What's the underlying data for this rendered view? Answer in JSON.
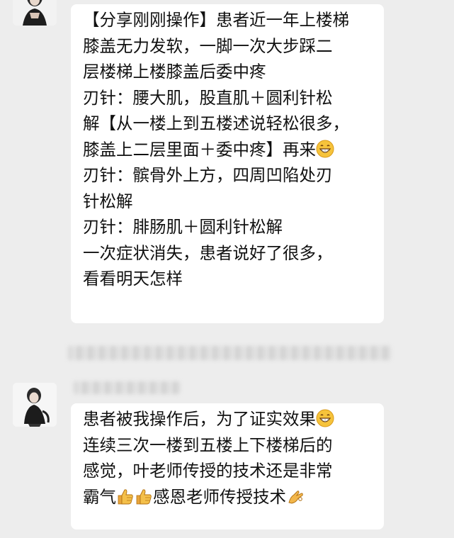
{
  "message1": {
    "lines": [
      "【分享刚刚操作】患者近一年上楼梯",
      "膝盖无力发软，一脚一次大步踩二",
      "层楼梯上楼膝盖后委中疼",
      "刃针：腰大肌，股直肌＋圆利针松",
      "解【从一楼上到五楼述说轻松很多，",
      "膝盖上二层里面＋委中疼】再来",
      "刃针：髌骨外上方，四周凹陷处刃",
      "针松解",
      "刃针：腓肠肌＋圆利针松解",
      "一次症状消失，患者说好了很多，",
      "看看明天怎样"
    ],
    "emoji_line6": "grinning-face-icon"
  },
  "message2": {
    "line1": "患者被我操作后，为了证实效果",
    "line2": "连续三次一楼到五楼上下楼梯后的",
    "line3": "感觉，叶老师传授的技术还是非常",
    "line4_a": "霸气",
    "line4_b": "感恩老师传授技术",
    "icons": [
      "grinning-face-icon",
      "thumbs-up-icon",
      "thumbs-up-icon",
      "ok-hand-icon"
    ]
  },
  "colors": {
    "background": "#ededed",
    "bubble": "#ffffff",
    "text": "#111111"
  }
}
